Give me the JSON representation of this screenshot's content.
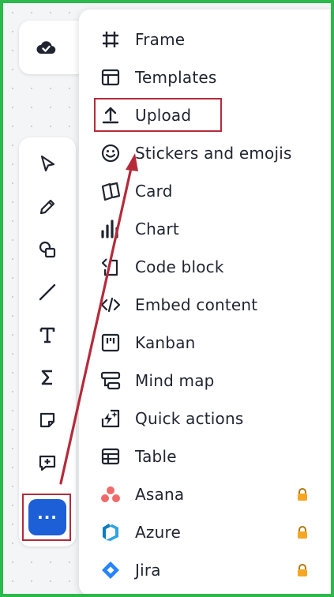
{
  "menu": {
    "items": [
      {
        "label": "Frame",
        "icon": "frame-icon"
      },
      {
        "label": "Templates",
        "icon": "templates-icon"
      },
      {
        "label": "Upload",
        "icon": "upload-icon"
      },
      {
        "label": "Stickers and emojis",
        "icon": "smiley-icon"
      },
      {
        "label": "Card",
        "icon": "card-icon"
      },
      {
        "label": "Chart",
        "icon": "chart-icon"
      },
      {
        "label": "Code block",
        "icon": "code-block-icon"
      },
      {
        "label": "Embed content",
        "icon": "embed-icon"
      },
      {
        "label": "Kanban",
        "icon": "kanban-icon"
      },
      {
        "label": "Mind map",
        "icon": "mind-map-icon"
      },
      {
        "label": "Quick actions",
        "icon": "quick-actions-icon"
      },
      {
        "label": "Table",
        "icon": "table-icon"
      },
      {
        "label": "Asana",
        "icon": "asana-icon",
        "locked": true
      },
      {
        "label": "Azure",
        "icon": "azure-icon",
        "locked": true
      },
      {
        "label": "Jira",
        "icon": "jira-icon",
        "locked": true
      }
    ]
  },
  "toolbar": {
    "tools": [
      "select-icon",
      "pen-icon",
      "shapes-icon",
      "line-icon",
      "text-icon",
      "formula-icon",
      "sticky-note-icon",
      "comment-icon"
    ],
    "more_label": "···"
  },
  "colors": {
    "accent": "#1d5fd6",
    "annotation": "#b52a3a",
    "frame_border": "#2db84b",
    "lock": "#f5a623"
  }
}
